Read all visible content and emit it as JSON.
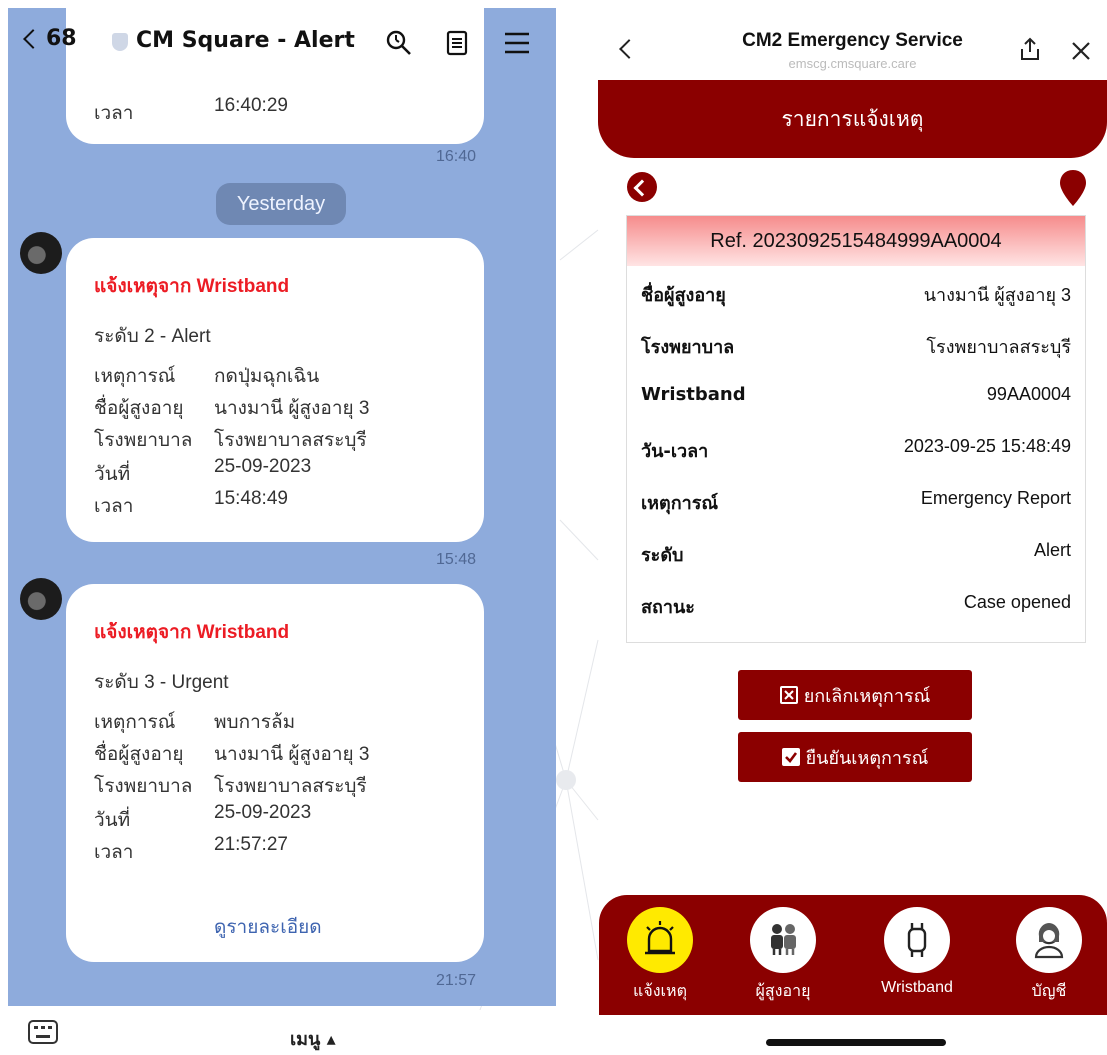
{
  "chat": {
    "header": {
      "back_count": "68",
      "title": "CM Square - Alert"
    },
    "top_partial": {
      "time_label": "เวลา",
      "time_value": "16:40:29",
      "stamp": "16:40"
    },
    "date_separator": "Yesterday",
    "messages": [
      {
        "title": "แจ้งเหตุจาก Wristband",
        "level": "ระดับ 2 - Alert",
        "rows": [
          {
            "k": "เหตุการณ์",
            "v": "กดปุ่มฉุกเฉิน"
          },
          {
            "k": "ชื่อผู้สูงอายุ",
            "v": "นางมานี ผู้สูงอายุ 3"
          },
          {
            "k": "โรงพยาบาล",
            "v": "โรงพยาบาลสระบุรี"
          },
          {
            "k": "วันที่",
            "v": "25-09-2023"
          },
          {
            "k": "เวลา",
            "v": "15:48:49"
          }
        ],
        "stamp": "15:48"
      },
      {
        "title": "แจ้งเหตุจาก Wristband",
        "level": "ระดับ 3 - Urgent",
        "rows": [
          {
            "k": "เหตุการณ์",
            "v": "พบการล้ม"
          },
          {
            "k": "ชื่อผู้สูงอายุ",
            "v": "นางมานี ผู้สูงอายุ 3"
          },
          {
            "k": "โรงพยาบาล",
            "v": "โรงพยาบาลสระบุรี"
          },
          {
            "k": "วันที่",
            "v": "25-09-2023"
          },
          {
            "k": "เวลา",
            "v": "21:57:27"
          }
        ],
        "link": "ดูรายละเอียด",
        "stamp": "21:57"
      }
    ],
    "footer": {
      "menu_label": "เมนู ▴"
    }
  },
  "web": {
    "title": "CM2 Emergency Service",
    "url": "emscg.cmsquare.care",
    "banner": "รายการแจ้งเหตุ",
    "ref": "Ref. 2023092515484999AA0004",
    "details": [
      {
        "k": "ชื่อผู้สูงอายุ",
        "v": "นางมานี ผู้สูงอายุ 3"
      },
      {
        "k": "โรงพยาบาล",
        "v": "โรงพยาบาลสระบุรี"
      },
      {
        "k": "Wristband",
        "v": "99AA0004"
      },
      {
        "k": "วัน-เวลา",
        "v": "2023-09-25 15:48:49"
      },
      {
        "k": "เหตุการณ์",
        "v": "Emergency Report"
      },
      {
        "k": "ระดับ",
        "v": "Alert"
      },
      {
        "k": "สถานะ",
        "v": "Case opened"
      }
    ],
    "cancel_label": "ยกเลิกเหตุการณ์",
    "confirm_label": "ยืนยันเหตุการณ์",
    "nav": [
      "แจ้งเหตุ",
      "ผู้สูงอายุ",
      "Wristband",
      "บัญชี"
    ]
  },
  "colors": {
    "brand_red": "#8b0000",
    "chat_bg": "#8eabdc",
    "alert_red": "#ec1c24",
    "active_nav": "#ffea00"
  }
}
